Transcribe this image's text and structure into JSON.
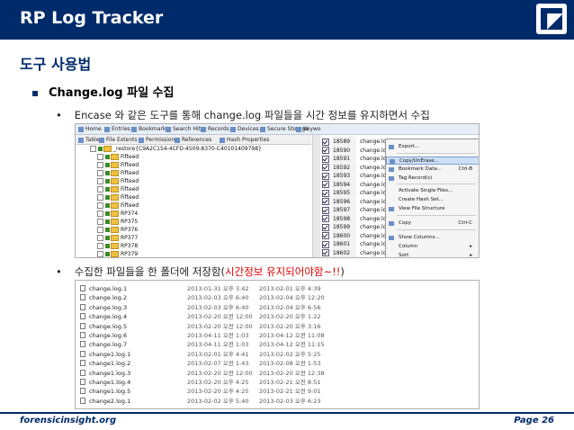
{
  "header": {
    "title": "RP Log Tracker"
  },
  "heading": "도구 사용법",
  "bullet1": "Change.log 파일 수집",
  "bullet2_dot": "•",
  "bullet2": "Encase 와 같은 도구를 통해 change.log 파일들을 시간 정보를 유지하면서 수집",
  "bullet3_main": "수집한 파일들을 한 폴더에 저장함(",
  "bullet3_red": "시간정보 유지되어야함~!!",
  "bullet3_end": ")",
  "shot1": {
    "tabs": [
      "Home",
      "Entries",
      "Bookmarks",
      "Search Hits",
      "Records",
      "Devices",
      "Secure Storage",
      "Keywo"
    ],
    "tabs2": [
      "Table",
      "File Extents",
      "Permissions",
      "References",
      "Hash Properties"
    ],
    "tree": [
      "_restore{C9A2C154-4CFD-4509-8370-C40101409798}",
      "Fifteed",
      "Fifteed",
      "Fifteed",
      "Fifteed",
      "Fifteed",
      "Fifteed",
      "Fifteed",
      "RP374",
      "RP375",
      "RP376",
      "RP377",
      "RP378",
      "RP379"
    ],
    "list": [
      {
        "num": "18589",
        "name": "change.log"
      },
      {
        "num": "18590",
        "name": "change.log.1"
      },
      {
        "num": "18591",
        "name": "change.log.1"
      },
      {
        "num": "18592",
        "name": "change.log.1"
      },
      {
        "num": "18593",
        "name": "change.log.1"
      },
      {
        "num": "18594",
        "name": "change.log.1"
      },
      {
        "num": "18595",
        "name": "change.log.1"
      },
      {
        "num": "18596",
        "name": "change.log.1"
      },
      {
        "num": "18597",
        "name": "change.log.1"
      },
      {
        "num": "18598",
        "name": "change.log.1"
      },
      {
        "num": "18599",
        "name": "change.log.1"
      },
      {
        "num": "18600",
        "name": "change.log.1"
      },
      {
        "num": "18601",
        "name": "change.log.1"
      },
      {
        "num": "18602",
        "name": "change.log.1"
      }
    ],
    "menu": [
      {
        "label": "Export...",
        "key": ""
      },
      {
        "label": "Copy/UnErase...",
        "key": ""
      },
      {
        "label": "Bookmark Data...",
        "key": "Ctrl-B"
      },
      {
        "label": "Tag Record(s)",
        "key": ""
      },
      {
        "label": "Activate Single Files...",
        "key": ""
      },
      {
        "label": "Create Hash Set...",
        "key": ""
      },
      {
        "label": "View File Structure",
        "key": ""
      },
      {
        "label": "Copy",
        "key": "Ctrl-C"
      },
      {
        "label": "Show Columns...",
        "key": ""
      },
      {
        "label": "Column",
        "key": "▸"
      },
      {
        "label": "Sort",
        "key": "▸"
      }
    ]
  },
  "files": [
    {
      "name": "change.log.1",
      "d1": "2013-01-31 오후 3:42",
      "d2": "2013-02-01 오후 4:39"
    },
    {
      "name": "change.log.2",
      "d1": "2013-02-03 오후 6:40",
      "d2": "2013-02-04 오후 12:20"
    },
    {
      "name": "change.log.3",
      "d1": "2013-02-03 오후 6:40",
      "d2": "2013-02-04 오후 6:56"
    },
    {
      "name": "change.log.4",
      "d1": "2013-02-20 오전 12:00",
      "d2": "2013-02-20 오후 1:22"
    },
    {
      "name": "change.log.5",
      "d1": "2013-02-20 오전 12:00",
      "d2": "2013-02-20 오후 3:16"
    },
    {
      "name": "change.log.6",
      "d1": "2013-04-11 오전 1:03",
      "d2": "2013-04-12 오전 11:08"
    },
    {
      "name": "change.log.7",
      "d1": "2013-04-11 오전 1:03",
      "d2": "2013-04-12 오전 11:15"
    },
    {
      "name": "change1.log.1",
      "d1": "2013-02-01 오후 4:41",
      "d2": "2013-02-02 오후 5:25"
    },
    {
      "name": "change1.log.2",
      "d1": "2013-02-07 오전 1:43",
      "d2": "2013-02-08 오전 1:53"
    },
    {
      "name": "change1.log.3",
      "d1": "2013-02-20 오전 12:00",
      "d2": "2013-02-20 오전 12:38"
    },
    {
      "name": "change1.log.4",
      "d1": "2013-02-20 오후 4:25",
      "d2": "2013-02-21 오전 8:51"
    },
    {
      "name": "change1.log.5",
      "d1": "2013-02-20 오후 4:25",
      "d2": "2013-02-21 오전 9:01"
    },
    {
      "name": "change2.log.1",
      "d1": "2013-02-02 오후 5:40",
      "d2": "2013-02-03 오후 6:23"
    }
  ],
  "footer": {
    "left": "forensicinsight.org",
    "right": "Page 26"
  },
  "colors": {
    "primary": "#002b6b",
    "accent_red": "#e00000"
  }
}
